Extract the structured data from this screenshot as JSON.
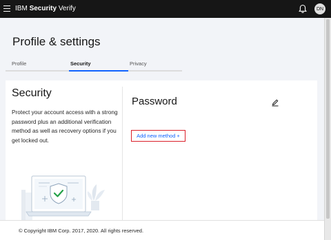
{
  "header": {
    "brand_prefix": "IBM",
    "brand_bold": "Security",
    "brand_suffix": "Verify",
    "avatar_initials": "DN"
  },
  "page": {
    "title": "Profile & settings"
  },
  "tabs": [
    {
      "label": "Profile",
      "active": false
    },
    {
      "label": "Security",
      "active": true
    },
    {
      "label": "Privacy",
      "active": false
    }
  ],
  "security": {
    "heading": "Security",
    "description": "Protect your account access with a strong password plus an additional verification method as well as recovery options if you get locked out."
  },
  "password": {
    "heading": "Password",
    "add_method_label": "Add new method +"
  },
  "footer": {
    "copyright": "© Copyright IBM Corp. 2017, 2020. All rights reserved."
  },
  "colors": {
    "header_bg": "#161616",
    "accent": "#0f62fe",
    "highlight_border": "#da1e28",
    "page_bg": "#f2f4f8",
    "check_green": "#24a148"
  },
  "icons": [
    "hamburger-menu-icon",
    "bell-icon",
    "edit-pencil-icon",
    "shield-check-icon"
  ]
}
